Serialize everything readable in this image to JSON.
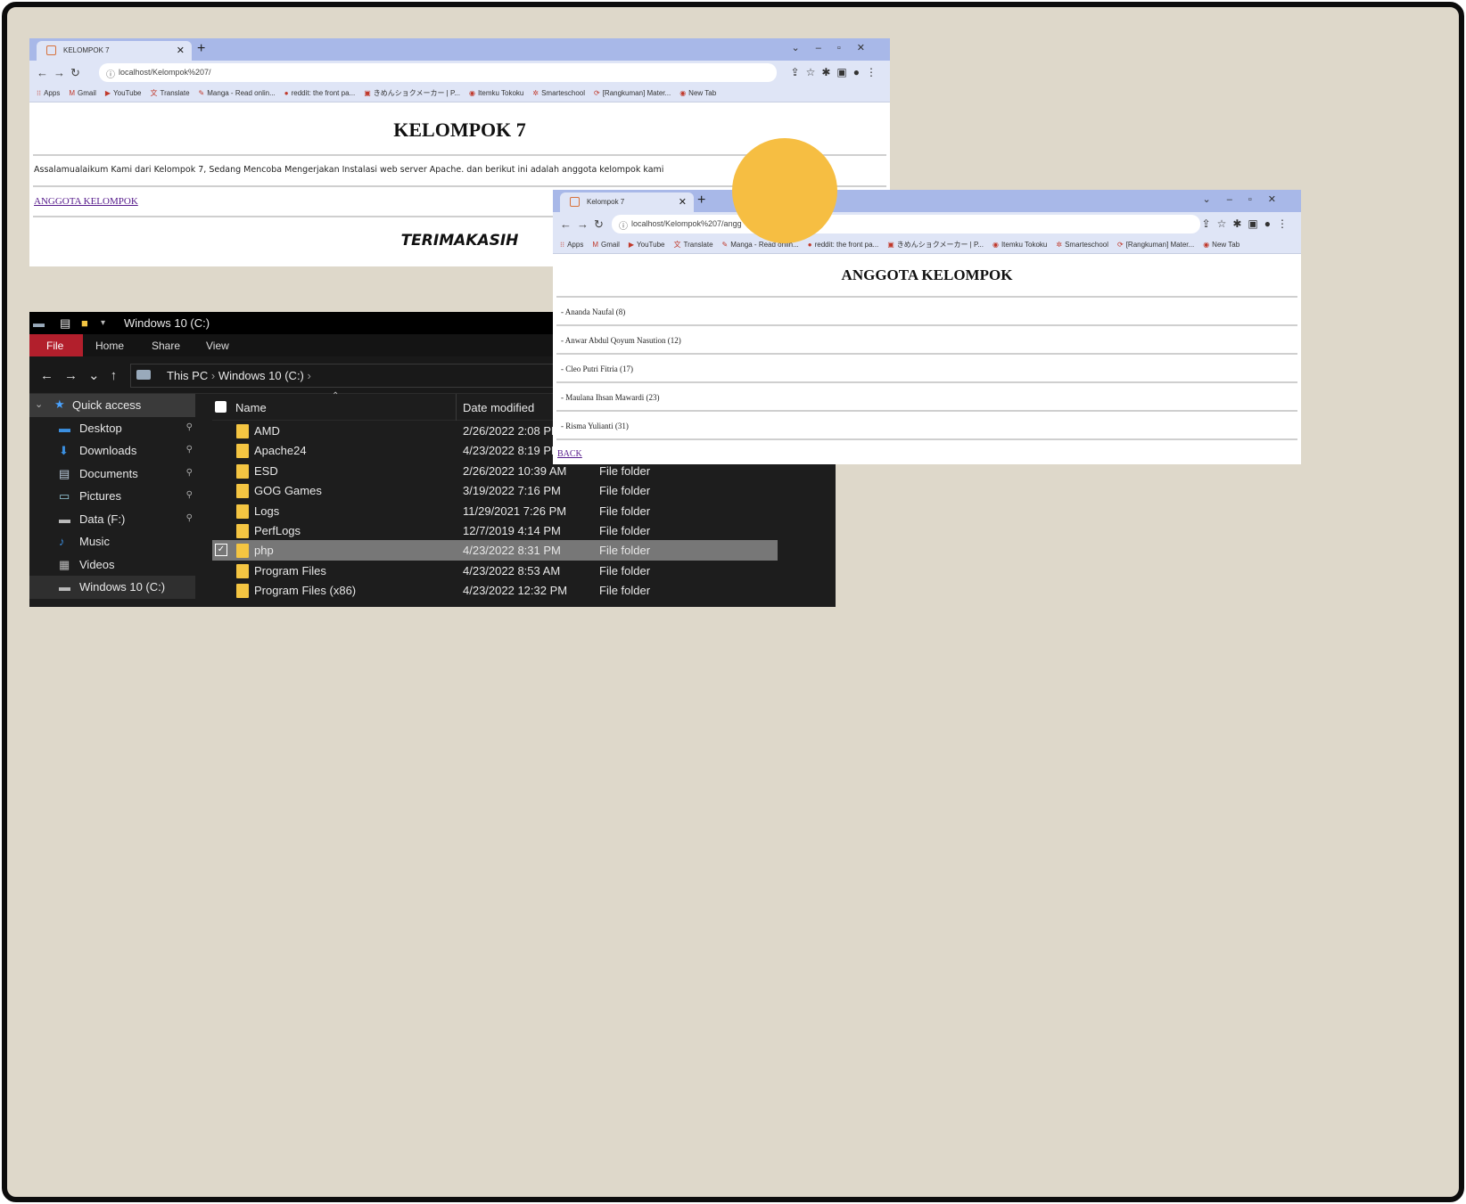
{
  "browser1": {
    "tab_title": "KELOMPOK 7",
    "url": "localhost/Kelompok%207/",
    "heading": "KELOMPOK 7",
    "intro": "Assalamualaikum Kami dari Kelompok 7, Sedang Mencoba Mengerjakan Instalasi web server Apache. dan berikut ini adalah anggota kelompok kami",
    "link": "ANGGOTA KELOMPOK",
    "closing": "TERIMAKASIH"
  },
  "bookmarks": [
    "Apps",
    "Gmail",
    "YouTube",
    "Translate",
    "Manga - Read onlin...",
    "reddit: the front pa...",
    "きめんショクメーカー | P...",
    "Itemku Tokoku",
    "Smarteschool",
    "[Rangkuman] Mater...",
    "New Tab"
  ],
  "browser2": {
    "tab_title": "Kelompok 7",
    "url": "localhost/Kelompok%207/angg",
    "heading": "ANGGOTA KELOMPOK",
    "members": [
      "- Ananda Naufal (8)",
      "- Anwar Abdul Qoyum Nasution (12)",
      "- Cleo Putri Fitria (17)",
      "- Maulana Ihsan Mawardi (23)",
      "- Risma Yulianti (31)"
    ],
    "back": "BACK"
  },
  "explorer": {
    "title": "Windows 10 (C:)",
    "ribbon": {
      "file": "File",
      "home": "Home",
      "share": "Share",
      "view": "View"
    },
    "breadcrumb": {
      "this_pc": "This PC",
      "drive": "Windows 10 (C:)"
    },
    "sidebar": [
      {
        "label": "Quick access",
        "icon": "star-icon"
      },
      {
        "label": "Desktop",
        "icon": "desktop-icon"
      },
      {
        "label": "Downloads",
        "icon": "download-icon"
      },
      {
        "label": "Documents",
        "icon": "document-icon"
      },
      {
        "label": "Pictures",
        "icon": "pictures-icon"
      },
      {
        "label": "Data (F:)",
        "icon": "drive-icon"
      },
      {
        "label": "Music",
        "icon": "music-icon"
      },
      {
        "label": "Videos",
        "icon": "video-icon"
      },
      {
        "label": "Windows 10 (C:)",
        "icon": "drive-icon"
      }
    ],
    "columns": {
      "name": "Name",
      "date": "Date modified"
    },
    "files": [
      {
        "name": "AMD",
        "date": "2/26/2022 2:08 PM",
        "type": ""
      },
      {
        "name": "Apache24",
        "date": "4/23/2022 8:19 PM",
        "type": ""
      },
      {
        "name": "ESD",
        "date": "2/26/2022 10:39 AM",
        "type": "File folder"
      },
      {
        "name": "GOG Games",
        "date": "3/19/2022 7:16 PM",
        "type": "File folder"
      },
      {
        "name": "Logs",
        "date": "11/29/2021 7:26 PM",
        "type": "File folder"
      },
      {
        "name": "PerfLogs",
        "date": "12/7/2019 4:14 PM",
        "type": "File folder"
      },
      {
        "name": "php",
        "date": "4/23/2022 8:31 PM",
        "type": "File folder"
      },
      {
        "name": "Program Files",
        "date": "4/23/2022 8:53 AM",
        "type": "File folder"
      },
      {
        "name": "Program Files (x86)",
        "date": "4/23/2022 12:32 PM",
        "type": "File folder"
      }
    ],
    "selected_index": 6
  },
  "colors": {
    "background": "#ded8ca",
    "accent_circle": "#f6be42",
    "chrome_tabbar": "#a8b8e8",
    "explorer_file_tab": "#b21f2c"
  }
}
